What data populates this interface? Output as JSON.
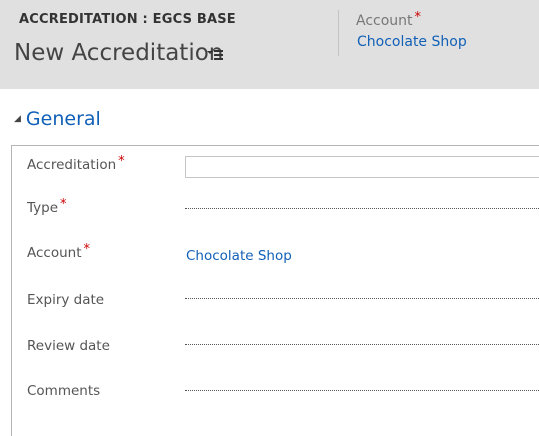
{
  "header": {
    "entity_title": "ACCREDITATION : EGCS BASE",
    "record_title": "New Accreditation",
    "account_label": "Account",
    "account_value": "Chocolate Shop",
    "required_mark": "*"
  },
  "section": {
    "title": "General"
  },
  "fields": {
    "accreditation": {
      "label": "Accreditation",
      "value": ""
    },
    "type": {
      "label": "Type"
    },
    "account": {
      "label": "Account",
      "value": "Chocolate Shop"
    },
    "expiry_date": {
      "label": "Expiry date"
    },
    "review_date": {
      "label": "Review date"
    },
    "comments": {
      "label": "Comments"
    }
  },
  "icons": {
    "form_menu": "list-menu-icon",
    "collapse": "triangle-collapse-icon"
  },
  "colors": {
    "header_bg": "#e0e0e0",
    "link": "#1160b7",
    "required": "#cc0000"
  }
}
